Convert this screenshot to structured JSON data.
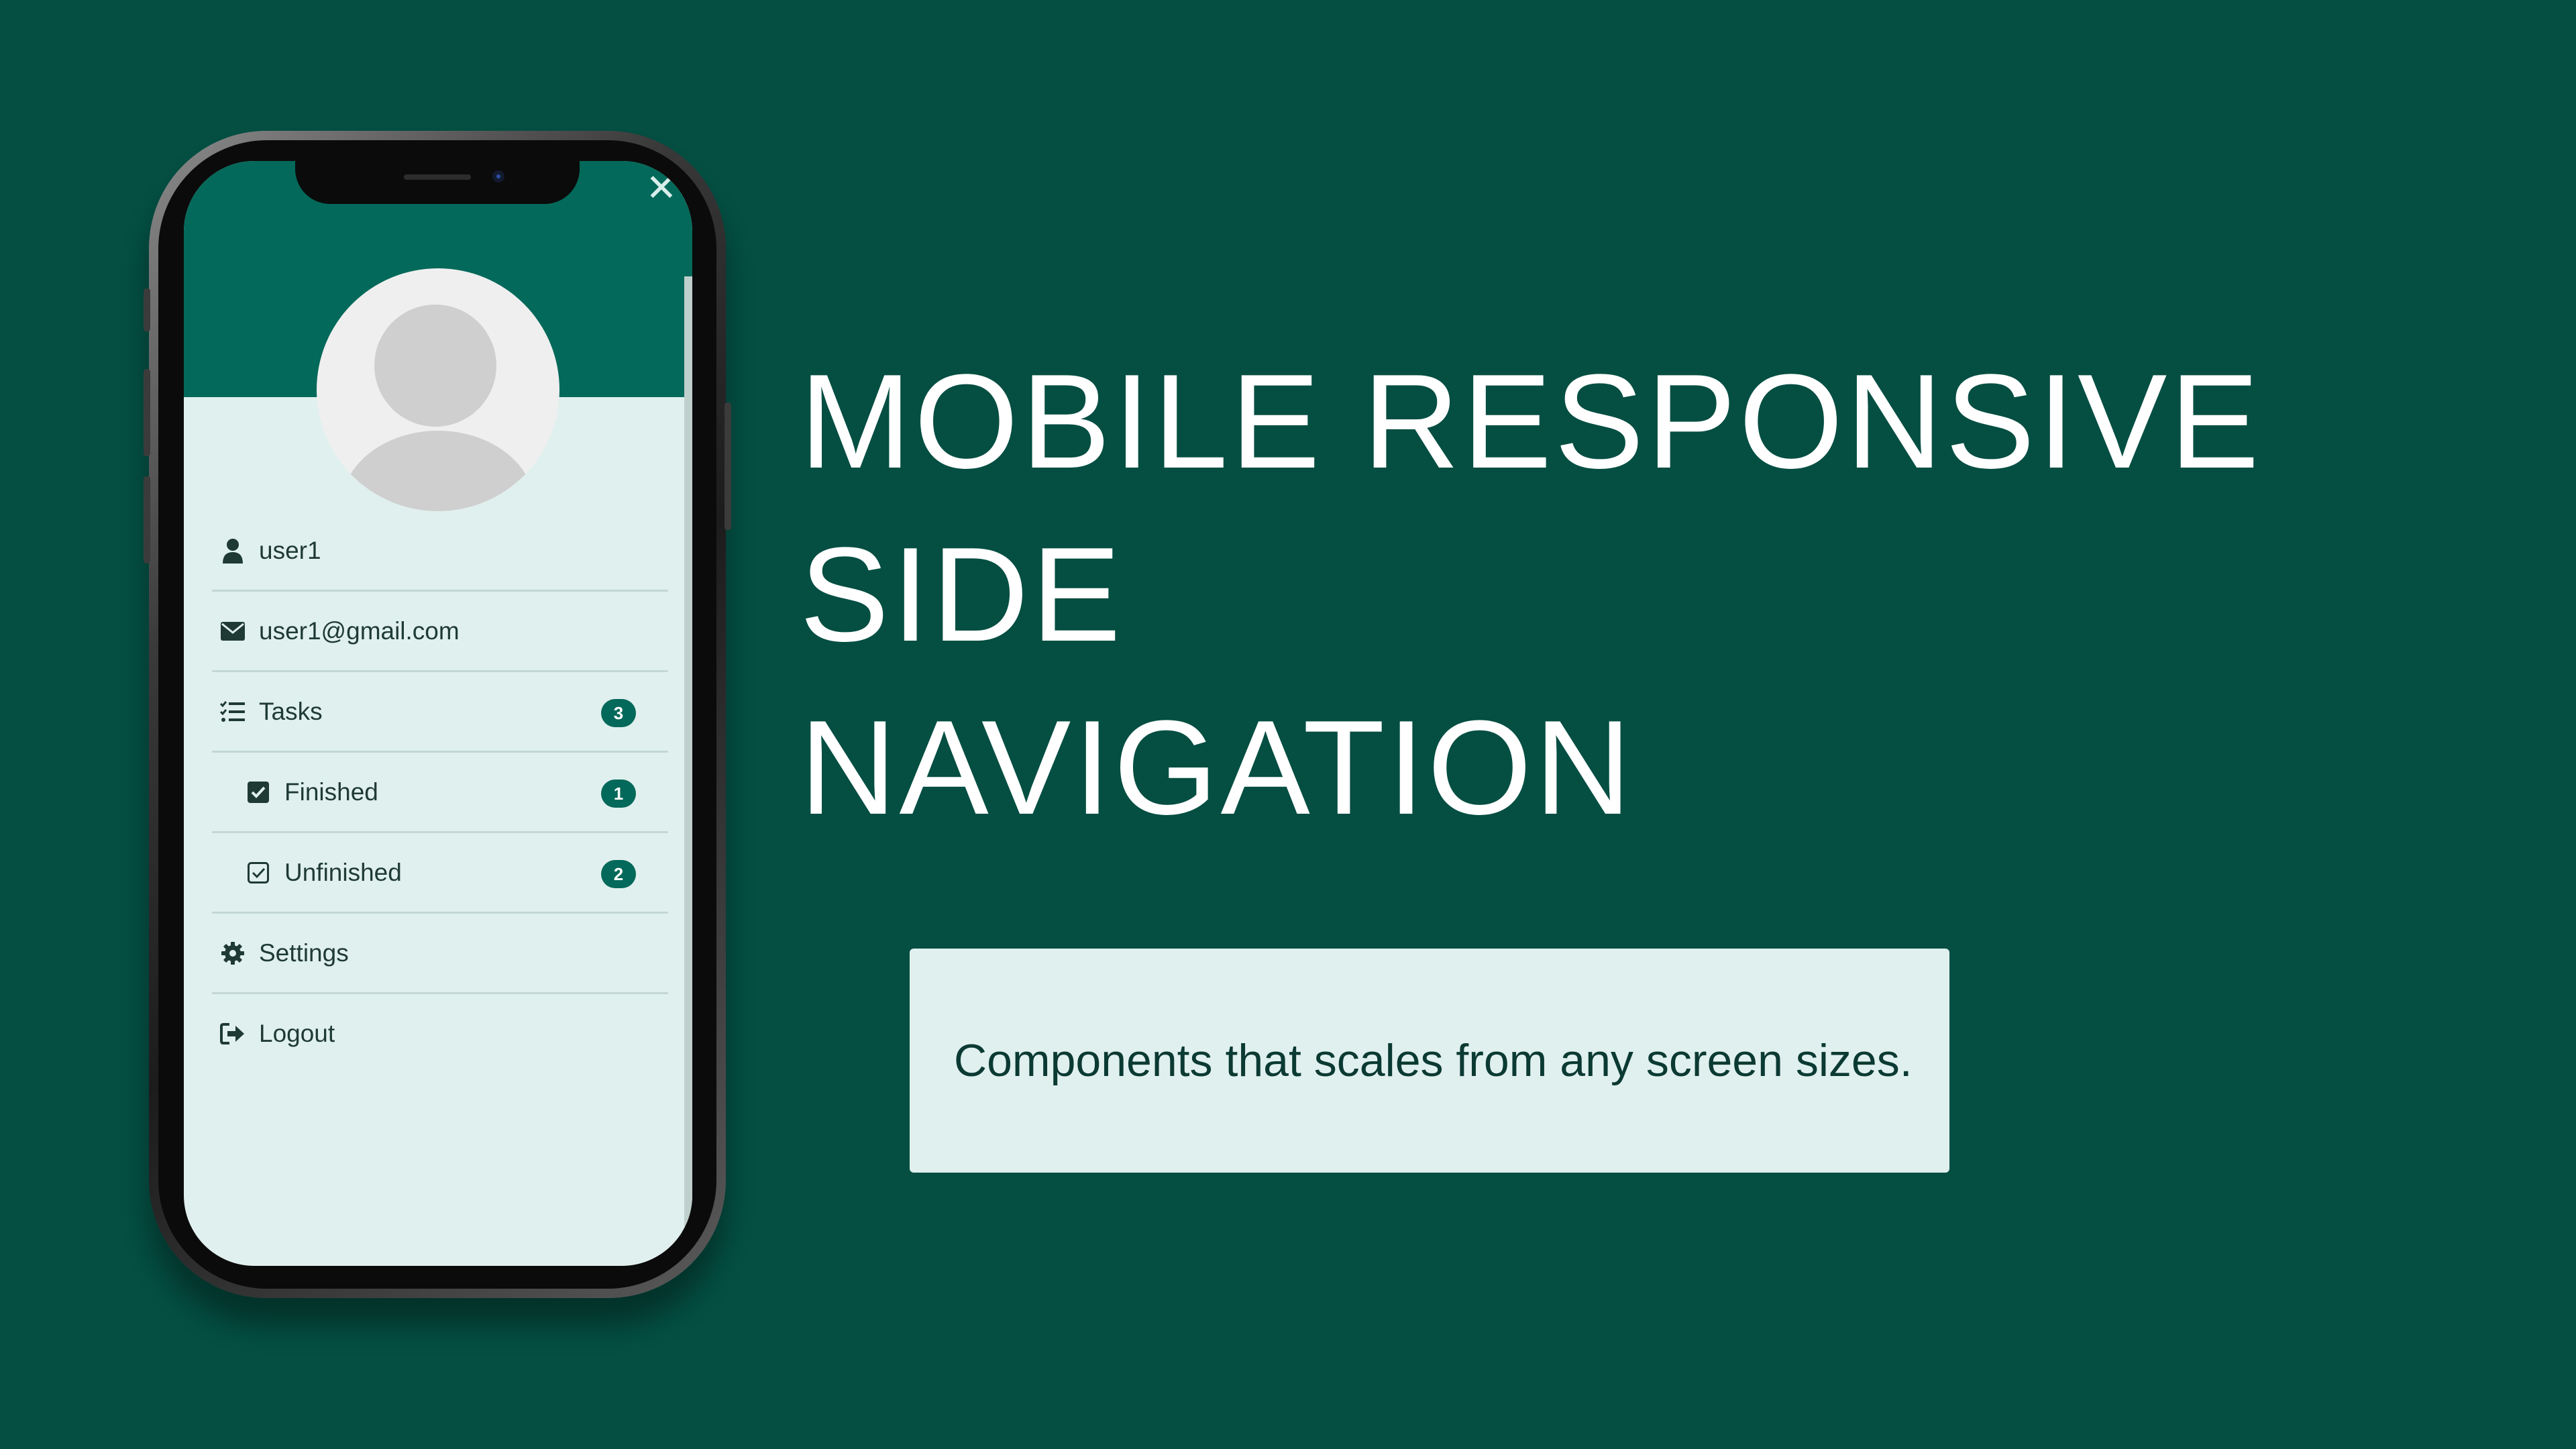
{
  "page": {
    "background": "#044e42"
  },
  "phone": {
    "header_color": "#03695a",
    "close_icon": "close-icon",
    "menu": [
      {
        "id": "username",
        "icon": "user-icon",
        "label": "user1"
      },
      {
        "id": "email",
        "icon": "envelope-icon",
        "label": "user1@gmail.com"
      },
      {
        "id": "tasks",
        "icon": "list-check-icon",
        "label": "Tasks",
        "badge": "3"
      },
      {
        "id": "finished",
        "icon": "checkbox-checked-icon",
        "label": "Finished",
        "badge": "1"
      },
      {
        "id": "unfinished",
        "icon": "checkbox-outline-icon",
        "label": "Unfinished",
        "badge": "2"
      },
      {
        "id": "settings",
        "icon": "gear-icon",
        "label": "Settings"
      },
      {
        "id": "logout",
        "icon": "logout-icon",
        "label": "Logout"
      }
    ]
  },
  "headline": {
    "line1": "MOBILE RESPONSIVE SIDE",
    "line2": "NAVIGATION"
  },
  "info_card": {
    "text": "Components that scales from any screen sizes."
  }
}
